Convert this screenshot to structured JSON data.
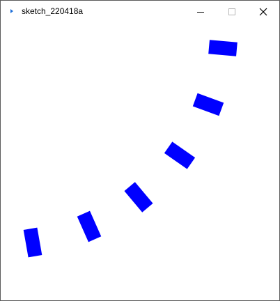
{
  "window": {
    "title": "sketch_220418a",
    "icon": "processing-sketch-icon",
    "controls": {
      "minimize": "minimize-icon",
      "maximize": "maximize-icon",
      "close": "close-icon"
    }
  },
  "canvas": {
    "background": "#ffffff",
    "shape_color": "#0000ff",
    "shape_count": 6
  }
}
